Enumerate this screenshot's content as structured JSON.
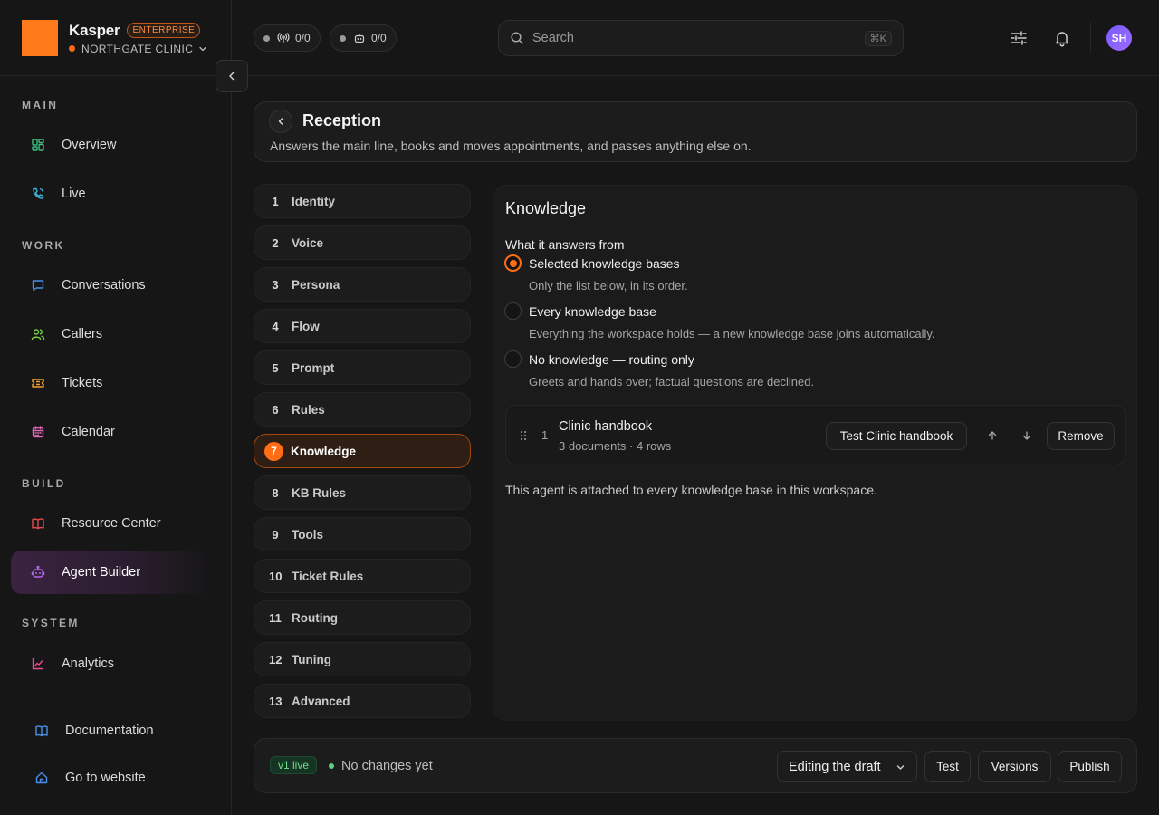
{
  "brand": {
    "name": "Kasper",
    "plan_badge": "ENTERPRISE",
    "org_name": "NORTHGATE CLINIC",
    "logo_color": "#ff7a1a"
  },
  "header": {
    "counters": [
      {
        "icon": "broadcast-icon",
        "value": "0/0"
      },
      {
        "icon": "robot-icon",
        "value": "0/0"
      }
    ],
    "search": {
      "placeholder": "Search",
      "shortcut": "⌘K"
    },
    "avatar_initials": "SH"
  },
  "sidebar": {
    "sections": [
      {
        "title": "MAIN",
        "items": [
          {
            "label": "Overview",
            "icon": "grid-icon",
            "color": "#3fbf7f"
          },
          {
            "label": "Live",
            "icon": "phone-icon",
            "color": "#3fb3d9"
          }
        ]
      },
      {
        "title": "WORK",
        "items": [
          {
            "label": "Conversations",
            "icon": "chat-icon",
            "color": "#4a8fe8"
          },
          {
            "label": "Callers",
            "icon": "users-icon",
            "color": "#7bd14a"
          },
          {
            "label": "Tickets",
            "icon": "ticket-icon",
            "color": "#f0a030"
          },
          {
            "label": "Calendar",
            "icon": "calendar-icon",
            "color": "#e066b8"
          }
        ]
      },
      {
        "title": "BUILD",
        "items": [
          {
            "label": "Resource Center",
            "icon": "book-icon",
            "color": "#e84a4a"
          },
          {
            "label": "Agent Builder",
            "icon": "robot-icon",
            "color": "#b06be8",
            "active": true
          }
        ]
      },
      {
        "title": "SYSTEM",
        "items": [
          {
            "label": "Analytics",
            "icon": "chart-icon",
            "color": "#e84a8f"
          }
        ]
      }
    ],
    "bottom": [
      {
        "label": "Documentation",
        "icon": "book-open-icon",
        "color": "#4a8fe8"
      },
      {
        "label": "Go to website",
        "icon": "home-icon",
        "color": "#4a8fe8"
      }
    ]
  },
  "agent": {
    "name": "Reception",
    "description": "Answers the main line, books and moves appointments, and passes anything else on."
  },
  "steps": [
    {
      "num": "1",
      "label": "Identity"
    },
    {
      "num": "2",
      "label": "Voice"
    },
    {
      "num": "3",
      "label": "Persona"
    },
    {
      "num": "4",
      "label": "Flow"
    },
    {
      "num": "5",
      "label": "Prompt"
    },
    {
      "num": "6",
      "label": "Rules"
    },
    {
      "num": "7",
      "label": "Knowledge",
      "active": true
    },
    {
      "num": "8",
      "label": "KB Rules"
    },
    {
      "num": "9",
      "label": "Tools"
    },
    {
      "num": "10",
      "label": "Ticket Rules"
    },
    {
      "num": "11",
      "label": "Routing"
    },
    {
      "num": "12",
      "label": "Tuning"
    },
    {
      "num": "13",
      "label": "Advanced"
    }
  ],
  "knowledge": {
    "title": "Knowledge",
    "subtitle": "What it answers from",
    "options": [
      {
        "label": "Selected knowledge bases",
        "help": "Only the list below, in its order.",
        "selected": true
      },
      {
        "label": "Every knowledge base",
        "help": "Everything the workspace holds — a new knowledge base joins automatically.",
        "selected": false
      },
      {
        "label": "No knowledge — routing only",
        "help": "Greets and hands over; factual questions are declined.",
        "selected": false
      }
    ],
    "kb_items": [
      {
        "index": "1",
        "name": "Clinic handbook",
        "meta": "3 documents · 4 rows",
        "test_label": "Test Clinic handbook",
        "remove_label": "Remove"
      }
    ],
    "note": "This agent is attached to every knowledge base in this workspace."
  },
  "footer": {
    "version_badge": "v1 live",
    "status": "No changes yet",
    "mode_select": "Editing the draft",
    "test_label": "Test",
    "versions_label": "Versions",
    "publish_label": "Publish"
  },
  "colors": {
    "accent": "#ff6d14",
    "live": "#5fd07e"
  }
}
